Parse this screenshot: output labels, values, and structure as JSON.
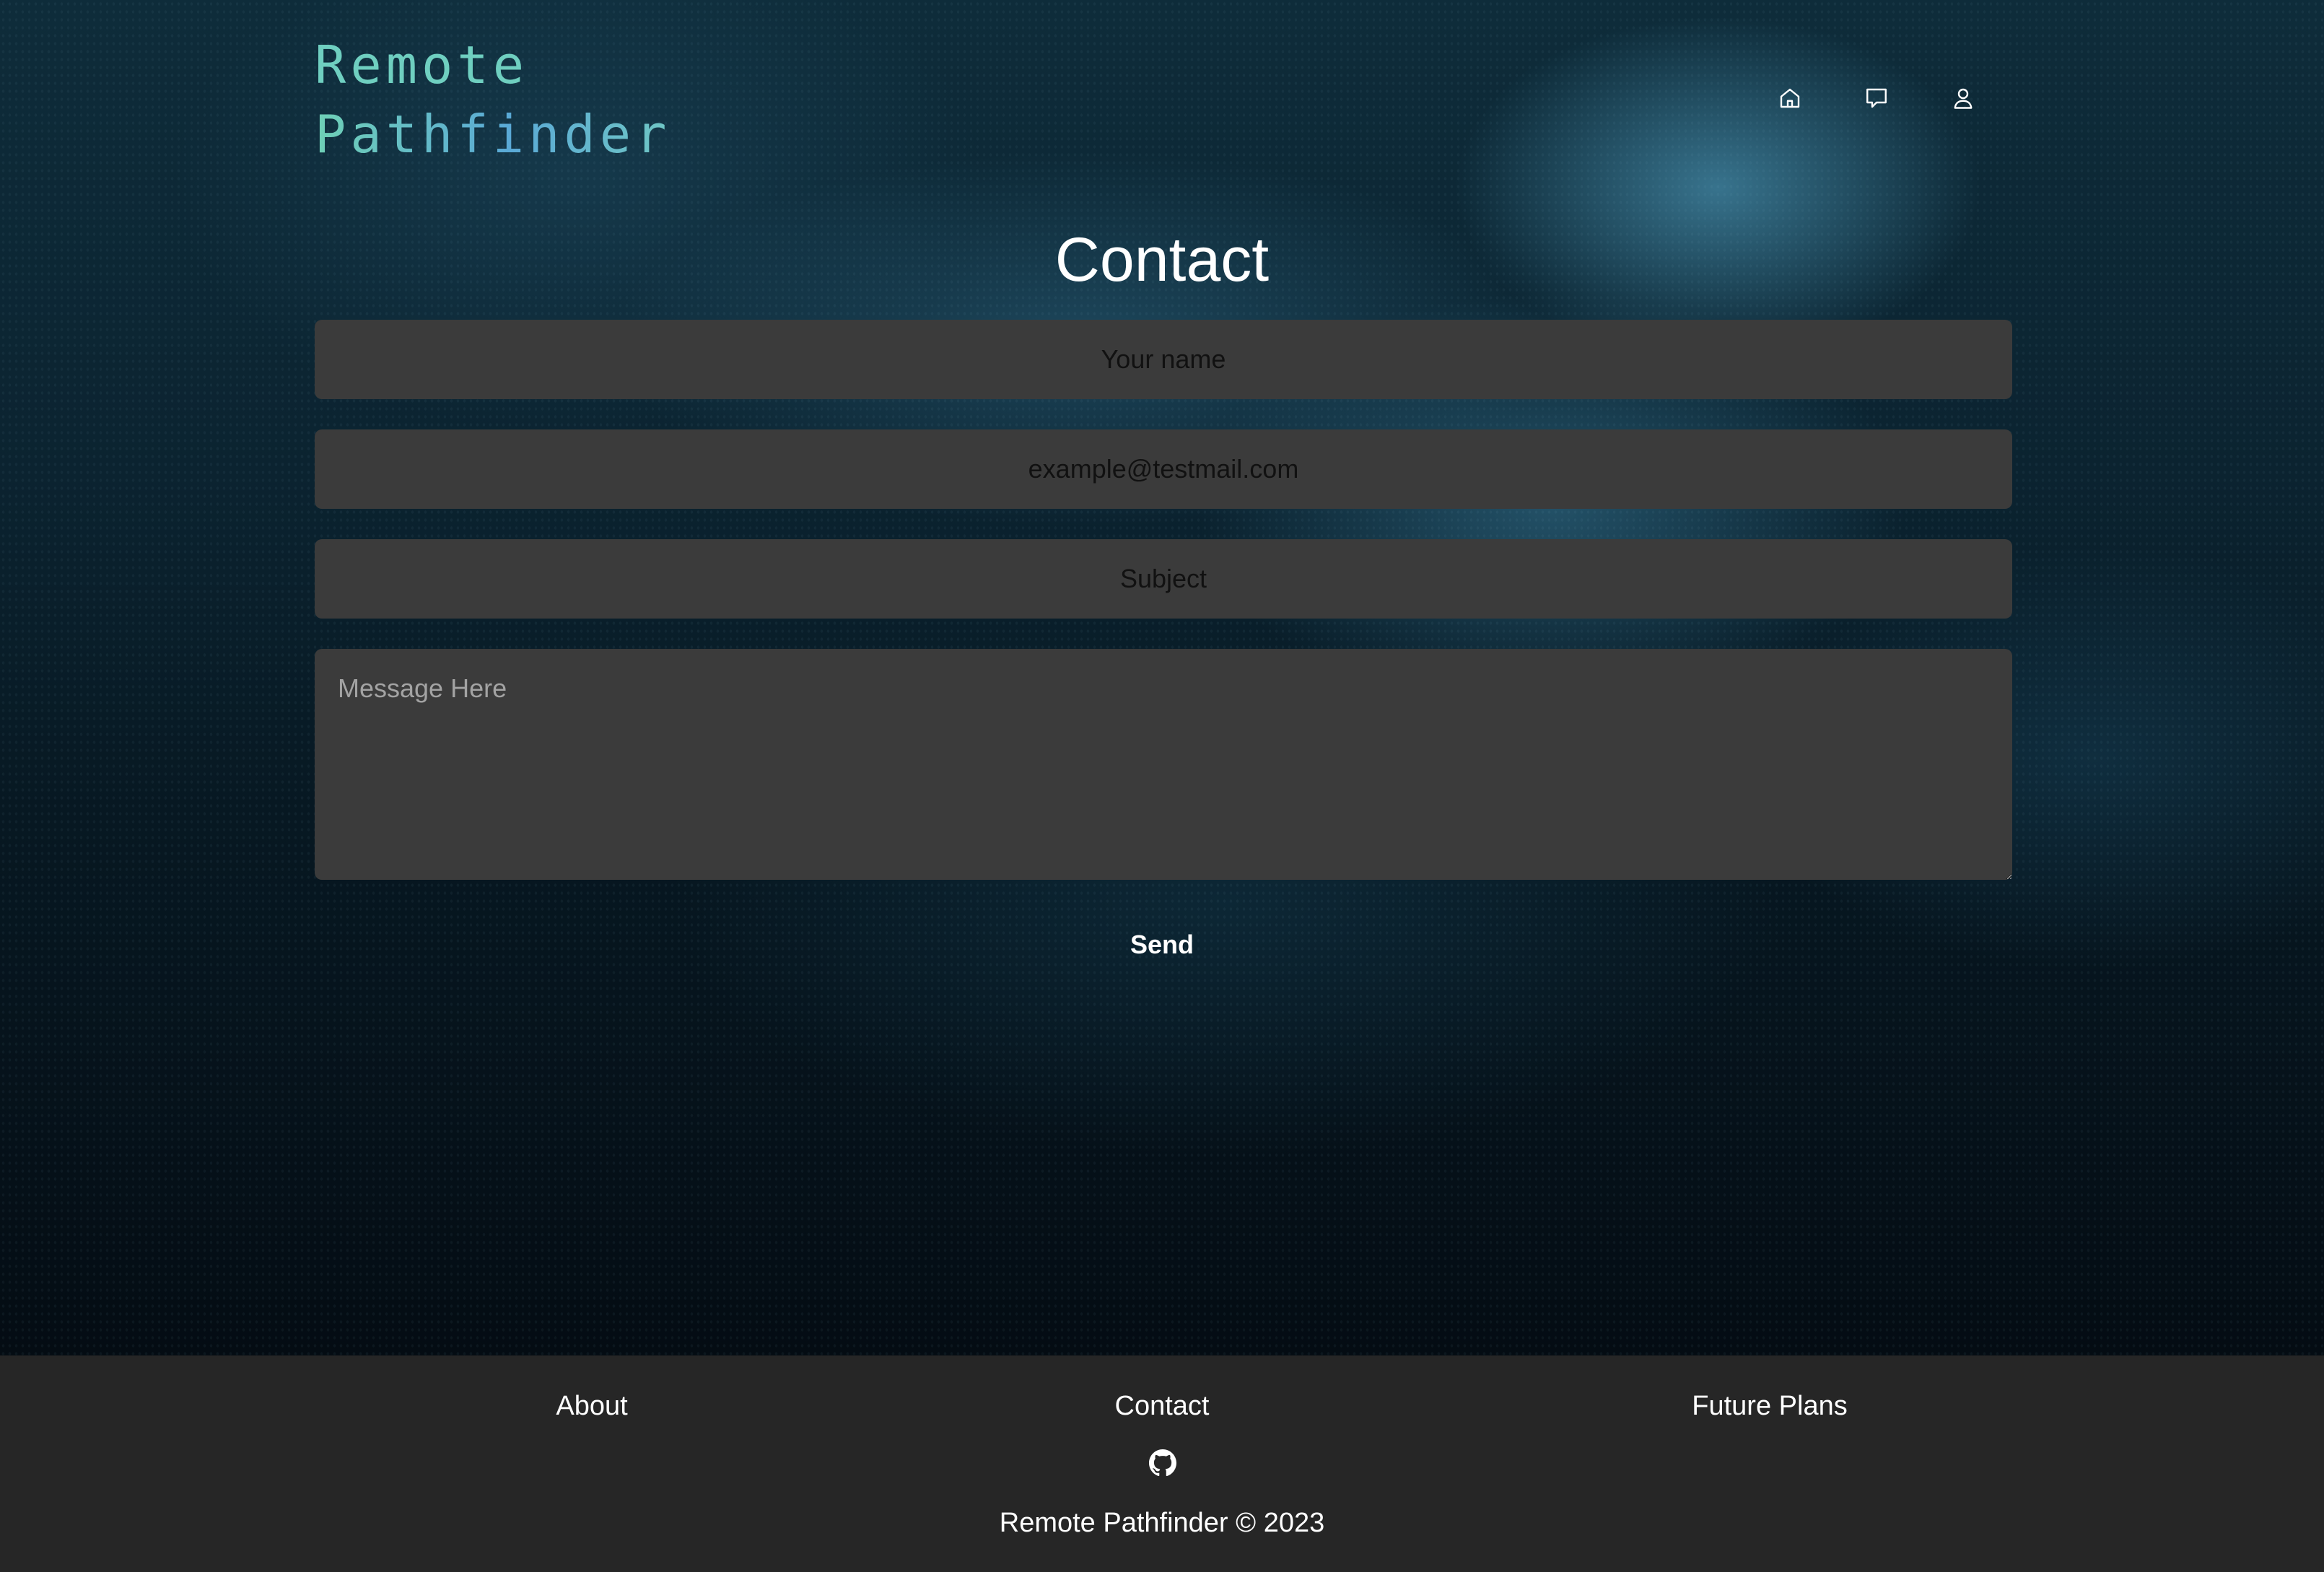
{
  "brand": {
    "line1": "Remote",
    "line2": "Pathfinder"
  },
  "nav": {
    "items": [
      {
        "icon": "home-icon"
      },
      {
        "icon": "chat-icon"
      },
      {
        "icon": "user-icon"
      }
    ]
  },
  "contact": {
    "title": "Contact",
    "name_placeholder": "Your name",
    "email_placeholder": "example@testmail.com",
    "subject_placeholder": "Subject",
    "message_placeholder": "Message Here",
    "send_label": "Send"
  },
  "footer": {
    "links": [
      "About",
      "Contact",
      "Future Plans"
    ],
    "github_icon": "github-icon",
    "copyright": "Remote Pathfinder © 2023"
  },
  "colors": {
    "logo_primary": "#6fcfc0",
    "logo_accent": "#5aa9d6",
    "field_background": "#3b3b3b",
    "footer_background": "#262626"
  }
}
